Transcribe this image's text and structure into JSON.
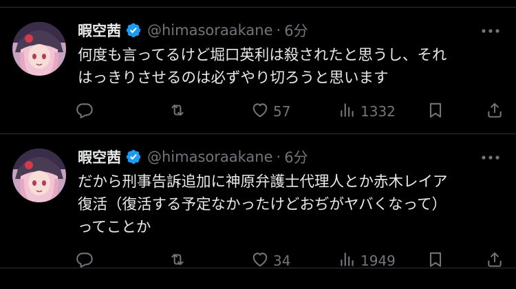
{
  "colors": {
    "background": "#000000",
    "text": "#e7e9ea",
    "muted": "#71767b",
    "verified": "#1d9bf0",
    "divider": "#2f3336"
  },
  "tweets": [
    {
      "author": {
        "name": "暇空茜",
        "handle": "@himasoraakane",
        "verified_icon": "verified-badge-icon",
        "avatar": "anime-girl-avatar"
      },
      "separator": "·",
      "time": "6分",
      "lines": [
        "何度も言ってるけど堀口英利は殺されたと思うし、それ",
        "はっきりさせるのは必ずやり切ろうと思います"
      ],
      "stats": {
        "reply_icon": "reply-icon",
        "repost_icon": "repost-icon",
        "like_icon": "heart-icon",
        "likes": "57",
        "views_icon": "views-icon",
        "views": "1332",
        "bookmark_icon": "bookmark-icon",
        "share_icon": "share-icon"
      }
    },
    {
      "author": {
        "name": "暇空茜",
        "handle": "@himasoraakane",
        "verified_icon": "verified-badge-icon",
        "avatar": "anime-girl-avatar"
      },
      "separator": "·",
      "time": "6分",
      "lines": [
        "だから刑事告訴追加に神原弁護士代理人とか赤木レイア",
        "復活（復活する予定なかったけどおぢがヤバくなって）",
        "ってことか"
      ],
      "stats": {
        "reply_icon": "reply-icon",
        "repost_icon": "repost-icon",
        "like_icon": "heart-icon",
        "likes": "34",
        "views_icon": "views-icon",
        "views": "1949",
        "bookmark_icon": "bookmark-icon",
        "share_icon": "share-icon"
      }
    }
  ]
}
